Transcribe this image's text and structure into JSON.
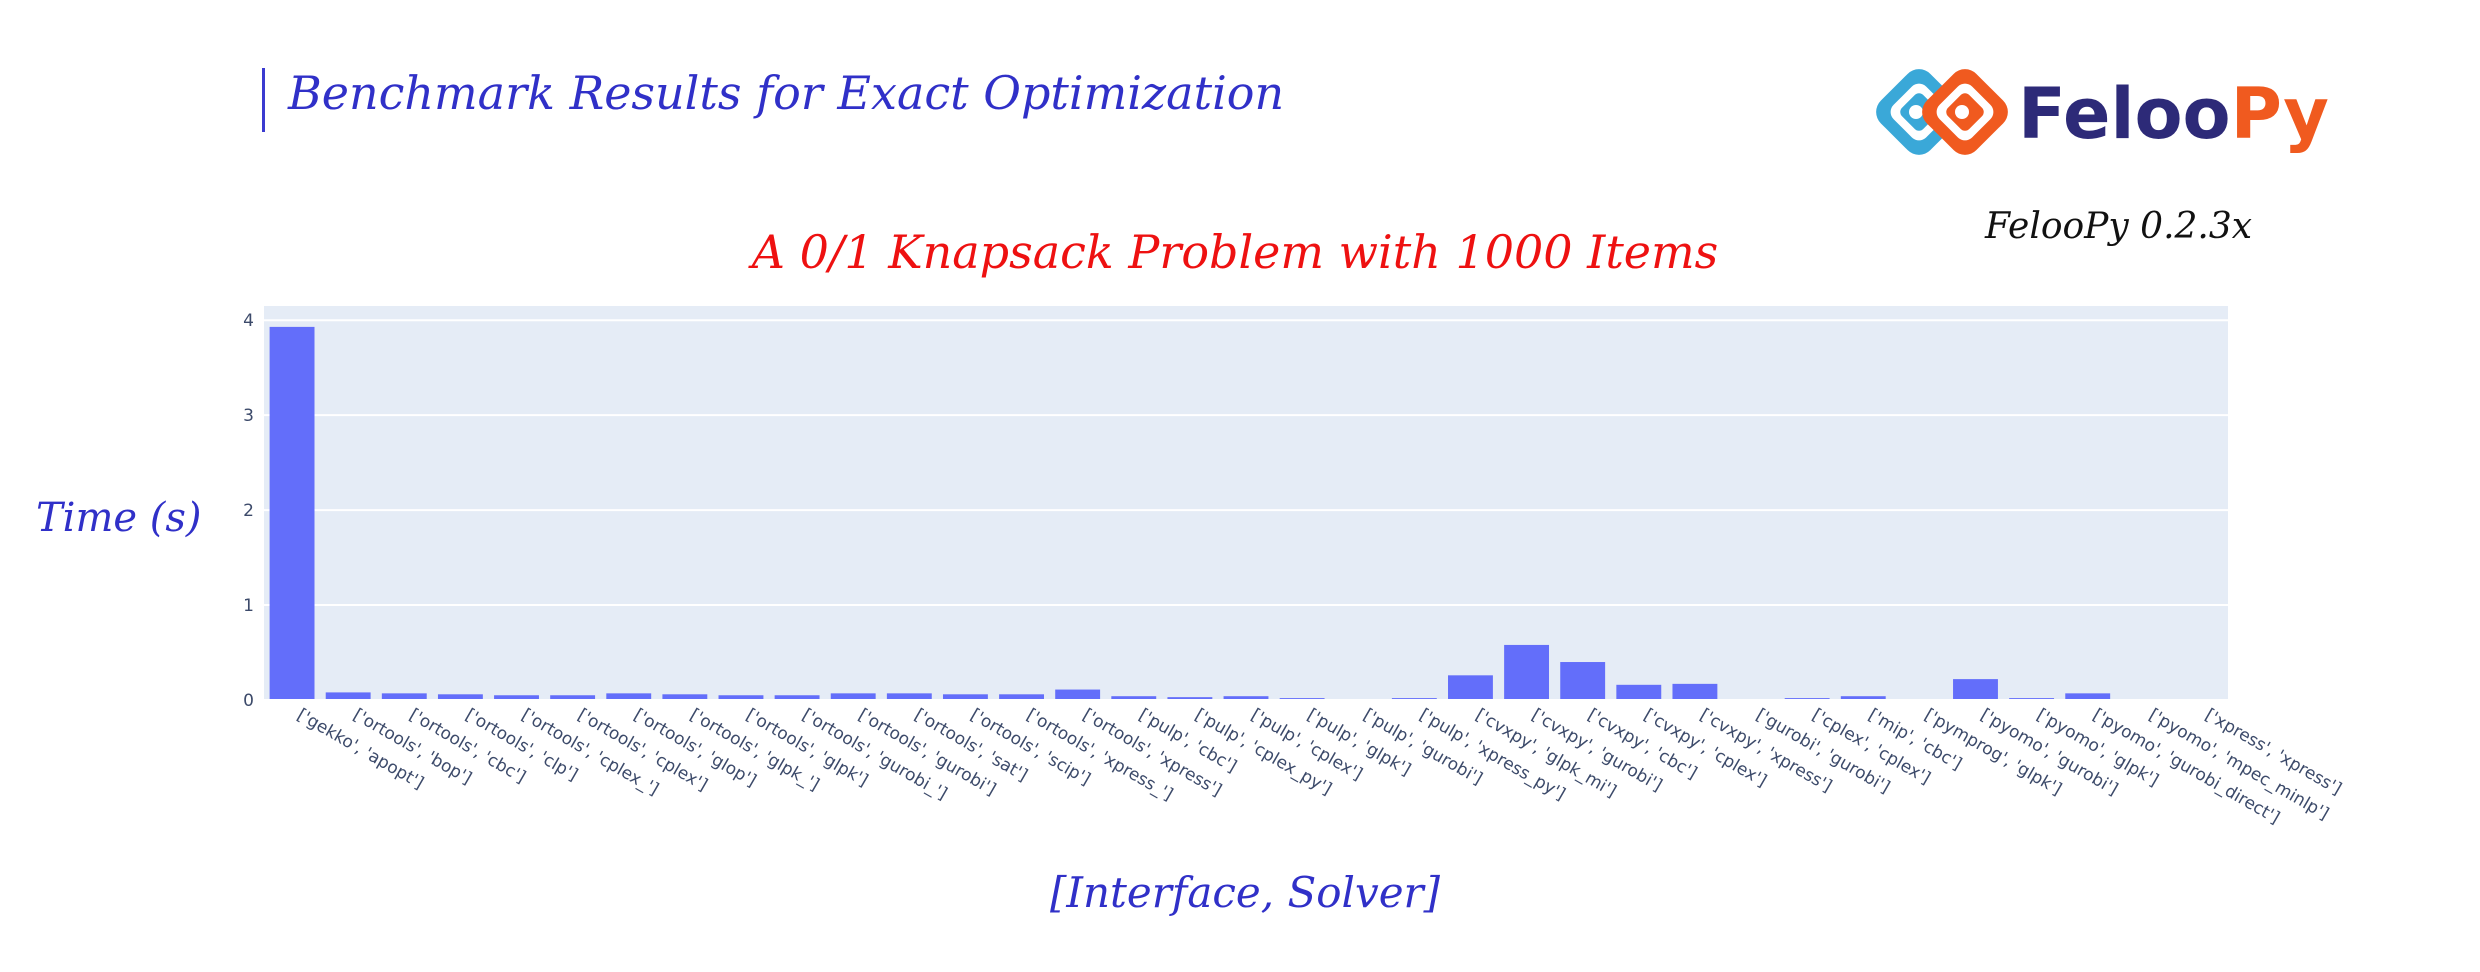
{
  "header": {
    "title": "Benchmark Results for Exact Optimization"
  },
  "logo": {
    "text_dark": "Feloo",
    "text_accent": "Py",
    "colors": {
      "blue": "#3aa8d8",
      "orange": "#f05a1f",
      "navy": "#2d2a78"
    }
  },
  "version": "FelooPy 0.2.3x",
  "colors": {
    "bar": "#636efa",
    "plot_bg": "#e5ecf6",
    "title": "#ee1111",
    "axis_title": "#3030c8"
  },
  "chart_data": {
    "type": "bar",
    "title": "A 0/1 Knapsack Problem with 1000 Items",
    "xlabel": "[Interface, Solver]",
    "ylabel": "Time (s)",
    "ylim": [
      0,
      4.15
    ],
    "yticks": [
      0,
      1,
      2,
      3,
      4
    ],
    "grid": true,
    "categories": [
      "['gekko', 'apopt']",
      "['ortools', 'bop']",
      "['ortools', 'cbc']",
      "['ortools', 'clp']",
      "['ortools', 'cplex_']",
      "['ortools', 'cplex']",
      "['ortools', 'glop']",
      "['ortools', 'glpk_']",
      "['ortools', 'glpk']",
      "['ortools', 'gurobi_']",
      "['ortools', 'gurobi']",
      "['ortools', 'sat']",
      "['ortools', 'scip']",
      "['ortools', 'xpress_']",
      "['ortools', 'xpress']",
      "['pulp', 'cbc']",
      "['pulp', 'cplex_py']",
      "['pulp', 'cplex']",
      "['pulp', 'glpk']",
      "['pulp', 'gurobi']",
      "['pulp', 'xpress_py']",
      "['cvxpy', 'glpk_mi']",
      "['cvxpy', 'gurobi']",
      "['cvxpy', 'cbc']",
      "['cvxpy', 'cplex']",
      "['cvxpy', 'xpress']",
      "['gurobi', 'gurobi']",
      "['cplex', 'cplex']",
      "['mip', 'cbc']",
      "['pymprog', 'glpk']",
      "['pyomo', 'gurobi']",
      "['pyomo', 'glpk']",
      "['pyomo', 'gurobi_direct']",
      "['pyomo', 'mpec_minlp']",
      "['xpress', 'xpress']"
    ],
    "values": [
      3.93,
      0.08,
      0.07,
      0.06,
      0.05,
      0.05,
      0.07,
      0.06,
      0.05,
      0.05,
      0.07,
      0.07,
      0.06,
      0.06,
      0.11,
      0.04,
      0.03,
      0.04,
      0.02,
      0.01,
      0.02,
      0.26,
      0.58,
      0.4,
      0.16,
      0.17,
      0.005,
      0.02,
      0.04,
      0.01,
      0.22,
      0.02,
      0.07,
      0.005,
      0.005
    ]
  }
}
